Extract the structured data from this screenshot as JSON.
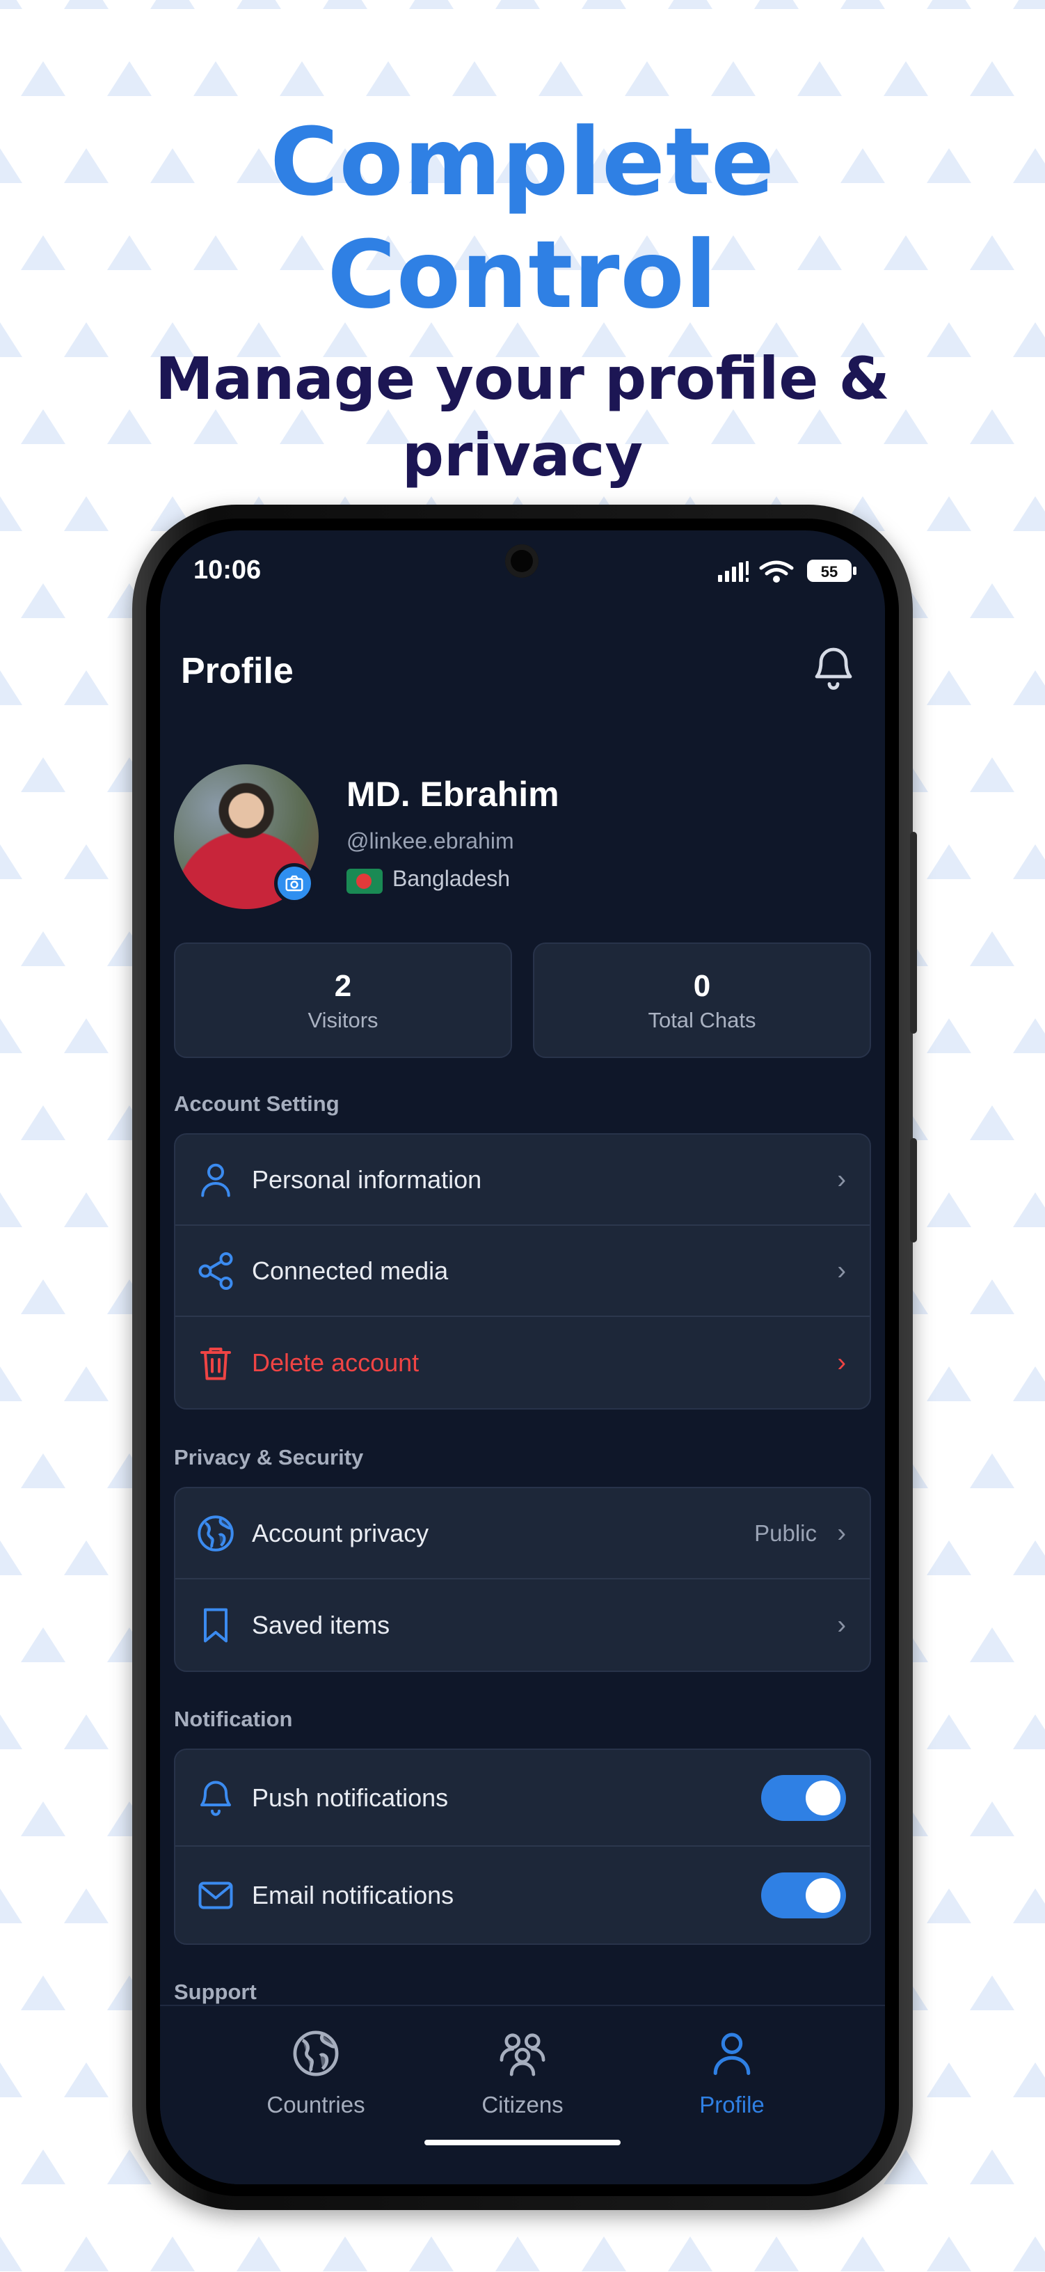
{
  "promo": {
    "title_line1": "Complete",
    "title_line2": "Control",
    "subtitle_line1": "Manage your profile &",
    "subtitle_line2": "privacy"
  },
  "status_bar": {
    "time": "10:06",
    "battery": "55"
  },
  "header": {
    "title": "Profile",
    "icon": "bell-icon"
  },
  "profile": {
    "name": "MD. Ebrahim",
    "handle": "@linkee.ebrahim",
    "country": "Bangladesh"
  },
  "stats": [
    {
      "value": "2",
      "label": "Visitors"
    },
    {
      "value": "0",
      "label": "Total Chats"
    }
  ],
  "sections": {
    "account": {
      "label": "Account Setting",
      "items": [
        {
          "label": "Personal information",
          "icon": "user-icon"
        },
        {
          "label": "Connected media",
          "icon": "share-icon"
        },
        {
          "label": "Delete account",
          "icon": "trash-icon"
        }
      ]
    },
    "privacy": {
      "label": "Privacy & Security",
      "items": [
        {
          "label": "Account privacy",
          "value": "Public",
          "icon": "globe-icon"
        },
        {
          "label": "Saved items",
          "icon": "bookmark-icon"
        }
      ]
    },
    "notification": {
      "label": "Notification",
      "items": [
        {
          "label": "Push notifications",
          "icon": "bell-icon",
          "enabled": true
        },
        {
          "label": "Email notifications",
          "icon": "mail-icon",
          "enabled": true
        }
      ]
    },
    "support": {
      "label": "Support"
    }
  },
  "chevron": "›",
  "nav": [
    {
      "label": "Countries",
      "icon": "globe-icon",
      "active": false
    },
    {
      "label": "Citizens",
      "icon": "people-icon",
      "active": false
    },
    {
      "label": "Profile",
      "icon": "user-icon",
      "active": true
    }
  ],
  "colors": {
    "accent": "#2f80e4",
    "danger": "#ef4444",
    "screen_bg": "#0f1729",
    "card_bg": "#1d2739",
    "subtitle": "#1c1654"
  }
}
